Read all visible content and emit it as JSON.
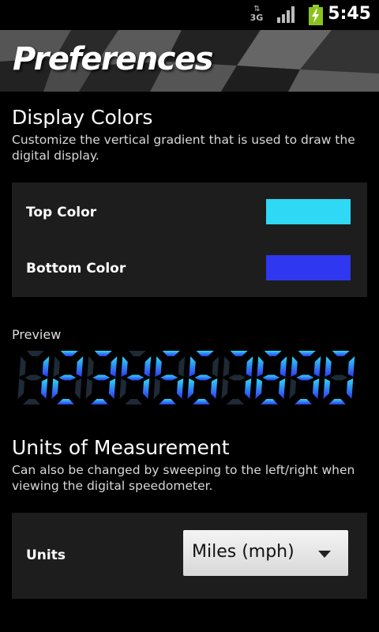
{
  "status_bar": {
    "network": "3G",
    "time": "5:45",
    "icons": [
      "data-arrows-icon",
      "signal-icon",
      "battery-charging-icon"
    ]
  },
  "header": {
    "title": "Preferences"
  },
  "display_colors": {
    "title": "Display Colors",
    "description": "Customize the vertical gradient that is used to draw the digital display.",
    "top_color": {
      "label": "Top Color",
      "value": "#2fd8f4"
    },
    "bottom_color": {
      "label": "Bottom Color",
      "value": "#3037f0"
    }
  },
  "preview": {
    "label": "Preview",
    "digits": "1234567890"
  },
  "units_section": {
    "title": "Units of Measurement",
    "description": "Can also be changed by sweeping to the left/right when viewing the digital speedometer.",
    "units_label": "Units",
    "selected": "Miles (mph)"
  }
}
